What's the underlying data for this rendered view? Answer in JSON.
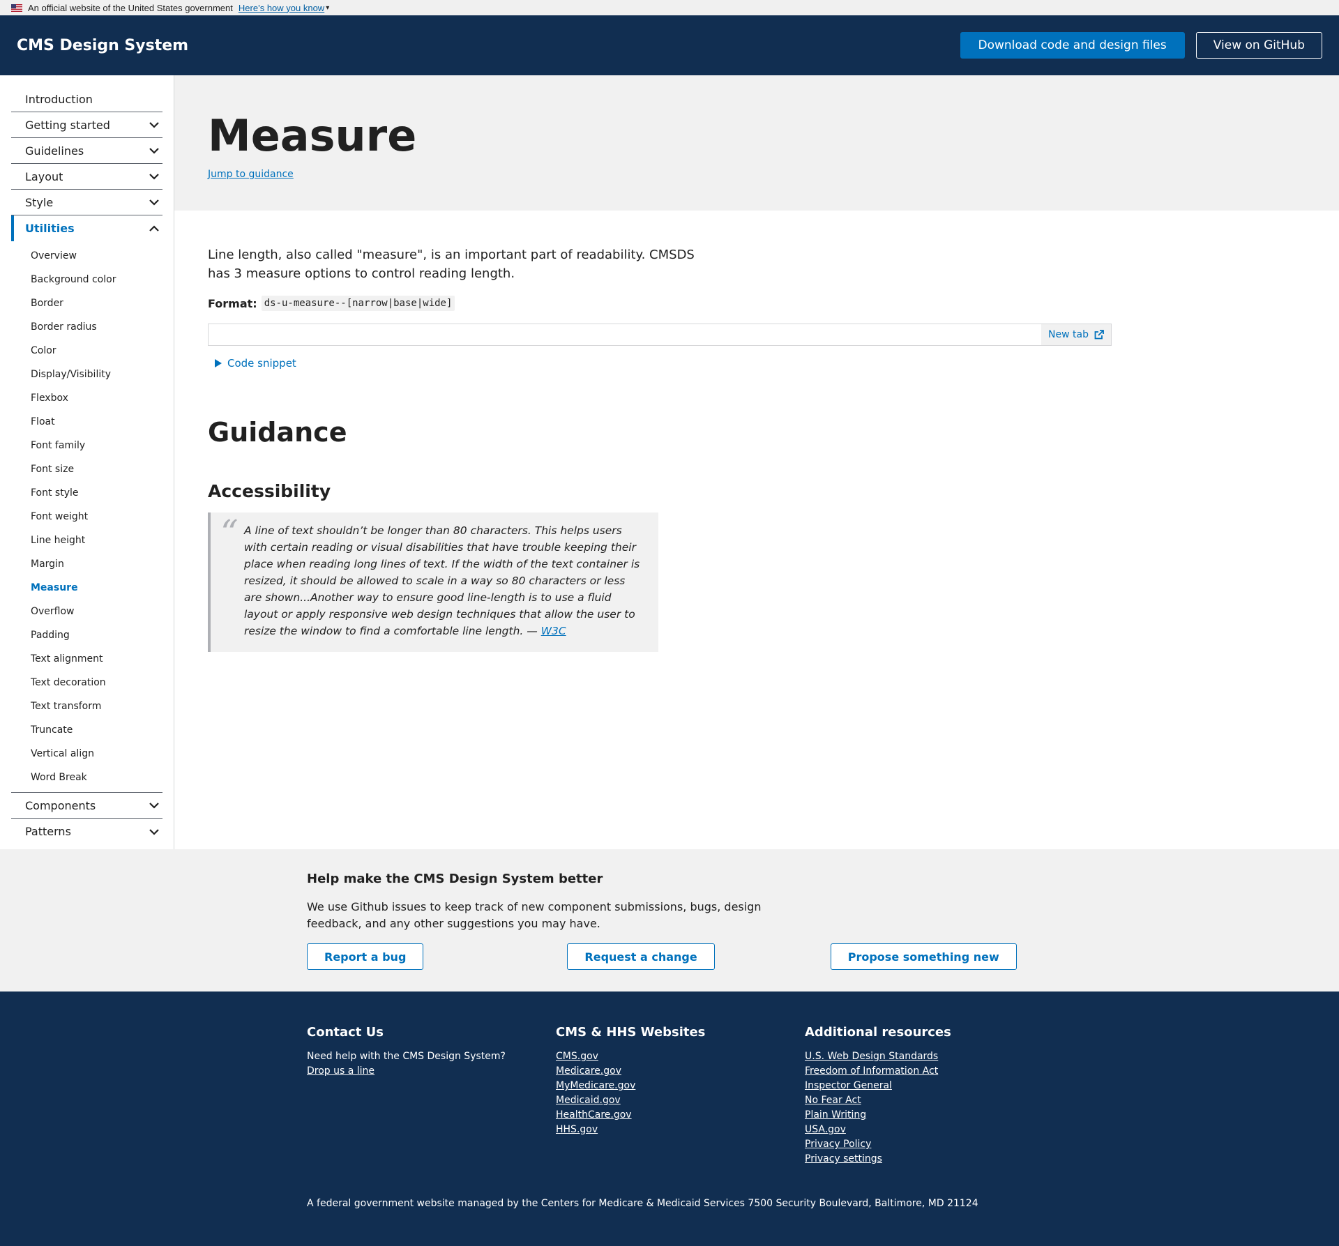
{
  "gov_banner": {
    "text": "An official website of the United States government",
    "link": "Here’s how you know"
  },
  "header": {
    "brand": "CMS Design System",
    "download_button": "Download code and design files",
    "github_button": "View on GitHub"
  },
  "sidebar": {
    "items": [
      {
        "label": "Introduction"
      },
      {
        "label": "Getting started"
      },
      {
        "label": "Guidelines"
      },
      {
        "label": "Layout"
      },
      {
        "label": "Style"
      },
      {
        "label": "Utilities"
      },
      {
        "label": "Components"
      },
      {
        "label": "Patterns"
      }
    ],
    "utilities_sub": [
      "Overview",
      "Background color",
      "Border",
      "Border radius",
      "Color",
      "Display/Visibility",
      "Flexbox",
      "Float",
      "Font family",
      "Font size",
      "Font style",
      "Font weight",
      "Line height",
      "Margin",
      "Measure",
      "Overflow",
      "Padding",
      "Text alignment",
      "Text decoration",
      "Text transform",
      "Truncate",
      "Vertical align",
      "Word Break"
    ]
  },
  "hero": {
    "title": "Measure",
    "jump_link": "Jump to guidance"
  },
  "main": {
    "intro": "Line length, also called \"measure\", is an important part of readability. CMSDS has 3 measure options to control reading length.",
    "format_label": "Format:",
    "format_code": "ds-u-measure--[narrow|base|wide]",
    "new_tab": "New tab",
    "code_snippet": "Code snippet",
    "guidance_heading": "Guidance",
    "accessibility_heading": "Accessibility",
    "quote_text": "A line of text shouldn’t be longer than 80 characters. This helps users with certain reading or visual disabilities that have trouble keeping their place when reading long lines of text. If the width of the text container is resized, it should be allowed to scale in a way so 80 characters or less are shown...Another way to ensure good line-length is to use a fluid layout or apply responsive web design techniques that allow the user to resize the window to find a comfortable line length. —",
    "quote_source": "W3C"
  },
  "feedback": {
    "heading": "Help make the CMS Design System better",
    "text": "We use Github issues to keep track of new component submissions, bugs, design feedback, and any other suggestions you may have.",
    "report_bug": "Report a bug",
    "request_change": "Request a change",
    "propose_new": "Propose something new"
  },
  "footer": {
    "contact_heading": "Contact Us",
    "contact_text": "Need help with the CMS Design System?",
    "contact_link": "Drop us a line",
    "websites_heading": "CMS & HHS Websites",
    "websites": [
      "CMS.gov",
      "Medicare.gov",
      "MyMedicare.gov",
      "Medicaid.gov",
      "HealthCare.gov",
      "HHS.gov"
    ],
    "resources_heading": "Additional resources",
    "resources": [
      "U.S. Web Design Standards",
      "Freedom of Information Act",
      "Inspector General",
      "No Fear Act",
      "Plain Writing",
      "USA.gov",
      "Privacy Policy",
      "Privacy settings"
    ],
    "bottom_text": "A federal government website managed by the Centers for Medicare & Medicaid Services 7500 Security Boulevard, Baltimore, MD 21124"
  },
  "colors": {
    "primary": "#0071bc",
    "navy": "#112e51",
    "gray_bg": "#f1f1f1"
  }
}
